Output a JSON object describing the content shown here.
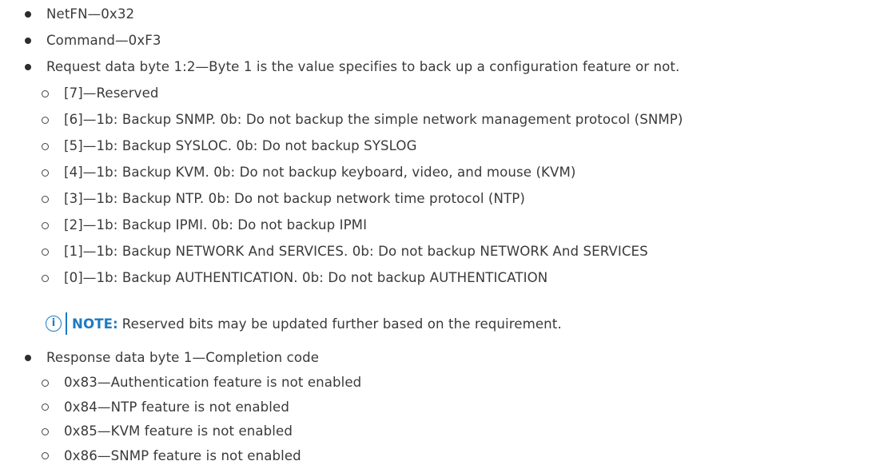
{
  "bullets": {
    "netfn": "NetFN—0x32",
    "command": "Command—0xF3",
    "request": "Request data byte 1:2—Byte 1 is the value specifies to back up a configuration feature or not.",
    "response": "Response data byte 1—Completion code"
  },
  "request_bits": [
    "[7]—Reserved",
    "[6]—1b: Backup SNMP. 0b: Do not backup the simple network management protocol (SNMP)",
    "[5]—1b: Backup SYSLOC. 0b: Do not backup SYSLOG",
    "[4]—1b: Backup KVM. 0b: Do not backup keyboard, video, and mouse (KVM)",
    "[3]—1b: Backup NTP. 0b: Do not backup network time protocol (NTP)",
    "[2]—1b: Backup IPMI. 0b: Do not backup IPMI",
    "[1]—1b: Backup NETWORK And SERVICES. 0b: Do not backup NETWORK And SERVICES",
    "[0]—1b: Backup AUTHENTICATION. 0b: Do not backup AUTHENTICATION"
  ],
  "note": {
    "icon": "info-icon",
    "icon_glyph": "i",
    "label": "NOTE:",
    "text": "Reserved bits may be updated further based on the requirement."
  },
  "response_codes": [
    "0x83—Authentication feature is not enabled",
    "0x84—NTP feature is not enabled",
    "0x85—KVM feature is not enabled",
    "0x86—SNMP feature is not enabled"
  ],
  "colors": {
    "text": "#3a3a3a",
    "note_accent": "#1b7bc2"
  }
}
